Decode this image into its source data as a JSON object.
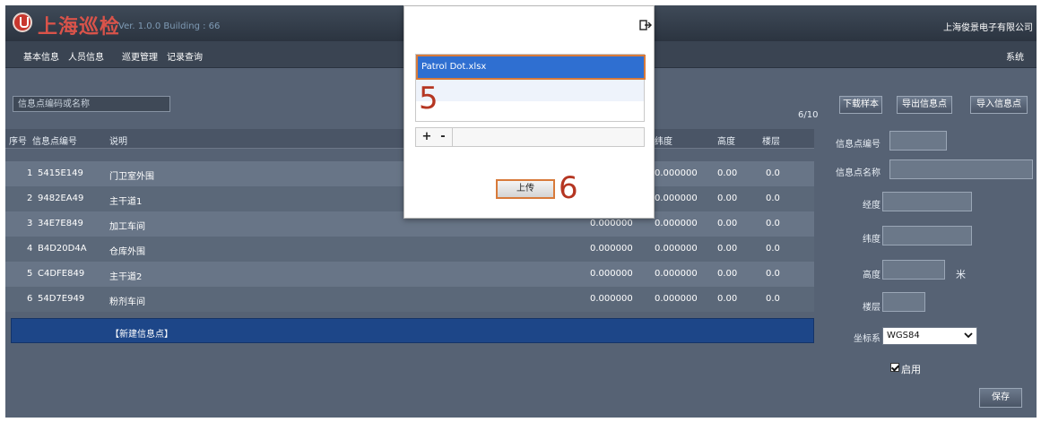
{
  "app": {
    "title": "上海巡检",
    "version": "Ver. 1.0.0 Building : 66",
    "company": "上海俊景电子有限公司"
  },
  "nav": {
    "items": [
      "基本信息",
      "人员信息",
      "巡更管理",
      "记录查询"
    ],
    "system": "系统"
  },
  "search": {
    "placeholder": "信息点编码或名称"
  },
  "page_count": "6/10",
  "buttons": {
    "download_template": "下载样本",
    "export_points": "导出信息点",
    "import_points": "导入信息点"
  },
  "table": {
    "headers": [
      "序号",
      "信息点编号",
      "说明",
      "纬度",
      "高度",
      "楼层"
    ],
    "rows": [
      {
        "index": "1",
        "code": "5415E149",
        "desc": "门卫室外围",
        "lng": "",
        "lat": "0.000000",
        "height": "0.00",
        "floor": "0.0"
      },
      {
        "index": "2",
        "code": "9482EA49",
        "desc": "主干道1",
        "lng": "",
        "lat": "0.000000",
        "height": "0.00",
        "floor": "0.0"
      },
      {
        "index": "3",
        "code": "34E7E849",
        "desc": "加工车间",
        "lng": "0.000000",
        "lat": "0.000000",
        "height": "0.00",
        "floor": "0.0"
      },
      {
        "index": "4",
        "code": "B4D20D4A",
        "desc": "仓库外围",
        "lng": "0.000000",
        "lat": "0.000000",
        "height": "0.00",
        "floor": "0.0"
      },
      {
        "index": "5",
        "code": "C4DFE849",
        "desc": "主干道2",
        "lng": "0.000000",
        "lat": "0.000000",
        "height": "0.00",
        "floor": "0.0"
      },
      {
        "index": "6",
        "code": "54D7E949",
        "desc": "粉剂车间",
        "lng": "0.000000",
        "lat": "0.000000",
        "height": "0.00",
        "floor": "0.0"
      }
    ],
    "new_row": "【新建信息点】"
  },
  "form": {
    "code_label": "信息点编号",
    "name_label": "信息点名称",
    "lng_label": "经度",
    "lat_label": "纬度",
    "height_label": "高度",
    "height_unit": "米",
    "floor_label": "楼层",
    "coord_label": "坐标系",
    "coord_value": "WGS84",
    "enable_label": "启用",
    "enable_checked": true,
    "save": "保存"
  },
  "modal": {
    "file": "Patrol Dot.xlsx",
    "step5": "5",
    "step6": "6",
    "add": "+",
    "remove": "-",
    "upload": "上传"
  },
  "colors": {
    "selected": "#2f6fd1",
    "annotation": "#b53622",
    "highlight_border": "#d87a3a"
  }
}
